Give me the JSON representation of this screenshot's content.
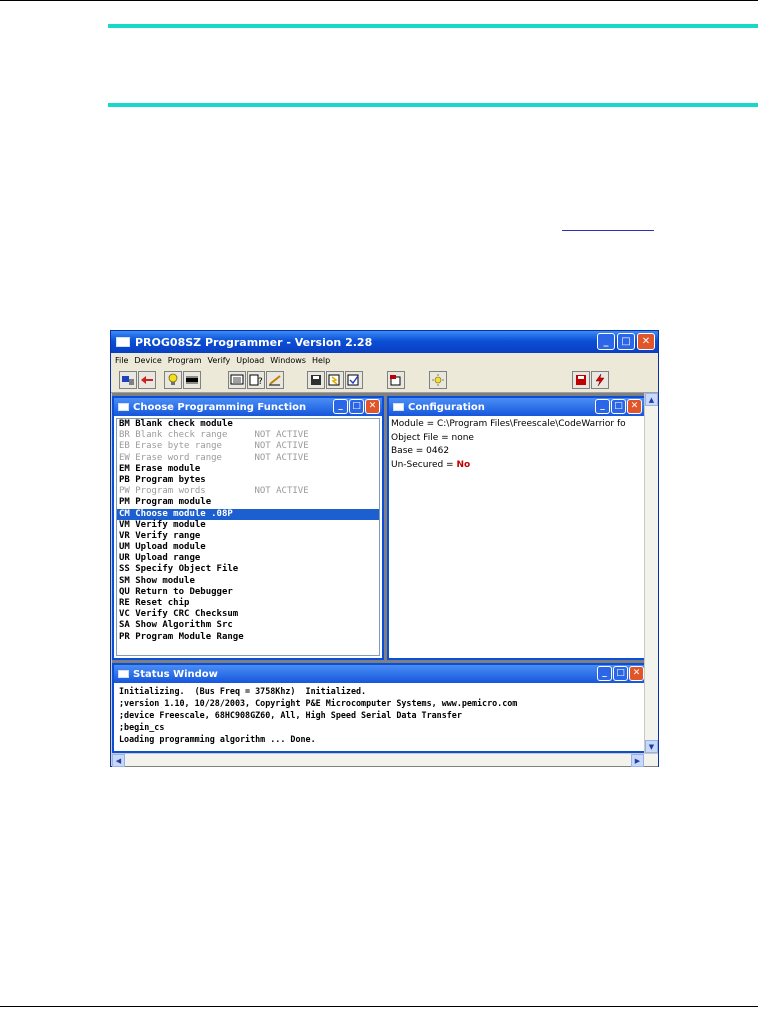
{
  "app": {
    "title": "PROG08SZ Programmer - Version 2.28",
    "menu": [
      "File",
      "Device",
      "Program",
      "Verify",
      "Upload",
      "Windows",
      "Help"
    ]
  },
  "toolbar_icons": [
    "connect-icon",
    "arrow-left-icon",
    "lightbulb-icon",
    "chip-icon",
    "screen-icon",
    "help-icon",
    "pen-icon",
    "floppy-icon",
    "program-icon",
    "verify-icon",
    "upload-icon",
    "reset-icon",
    "floppy-red-icon",
    "lightning-icon"
  ],
  "function_window": {
    "title": "Choose Programming Function",
    "items": [
      {
        "text": "BM Blank check module",
        "active": true,
        "selected": false
      },
      {
        "text": "BR Blank check range     NOT ACTIVE",
        "active": false,
        "selected": false
      },
      {
        "text": "EB Erase byte range      NOT ACTIVE",
        "active": false,
        "selected": false
      },
      {
        "text": "EW Erase word range      NOT ACTIVE",
        "active": false,
        "selected": false
      },
      {
        "text": "EM Erase module",
        "active": true,
        "selected": false
      },
      {
        "text": "PB Program bytes",
        "active": true,
        "selected": false
      },
      {
        "text": "PW Program words         NOT ACTIVE",
        "active": false,
        "selected": false
      },
      {
        "text": "PM Program module",
        "active": true,
        "selected": false
      },
      {
        "text": "CM Choose module .08P",
        "active": true,
        "selected": true
      },
      {
        "text": "VM Verify module",
        "active": true,
        "selected": false
      },
      {
        "text": "VR Verify range",
        "active": true,
        "selected": false
      },
      {
        "text": "UM Upload module",
        "active": true,
        "selected": false
      },
      {
        "text": "UR Upload range",
        "active": true,
        "selected": false
      },
      {
        "text": "SS Specify Object File",
        "active": true,
        "selected": false
      },
      {
        "text": "SM Show module",
        "active": true,
        "selected": false
      },
      {
        "text": "QU Return to Debugger",
        "active": true,
        "selected": false
      },
      {
        "text": "RE Reset chip",
        "active": true,
        "selected": false
      },
      {
        "text": "VC Verify CRC Checksum",
        "active": true,
        "selected": false
      },
      {
        "text": "SA Show Algorithm Src",
        "active": true,
        "selected": false
      },
      {
        "text": "PR Program Module Range",
        "active": true,
        "selected": false
      }
    ]
  },
  "config_window": {
    "title": "Configuration",
    "module": "Module = C:\\Program Files\\Freescale\\CodeWarrior fo",
    "object_file": "Object File = none",
    "base": "Base = 0462",
    "secured_label": "Un-Secured = ",
    "secured_value": "No"
  },
  "status_window": {
    "title": "Status Window",
    "lines": [
      "Initializing.  (Bus Freq = 3758Khz)  Initialized.",
      ";version 1.10, 10/28/2003, Copyright P&E Microcomputer Systems, www.pemicro.com",
      ";device Freescale, 68HC908GZ60, All, High Speed Serial Data Transfer",
      ";begin_cs",
      "Loading programming algorithm ... Done."
    ]
  },
  "colors": {
    "accent_rule": "#18d8c8",
    "titlebar": "#0b4fd6",
    "selection": "#1c5fd0",
    "secured_value": "#c00000"
  }
}
